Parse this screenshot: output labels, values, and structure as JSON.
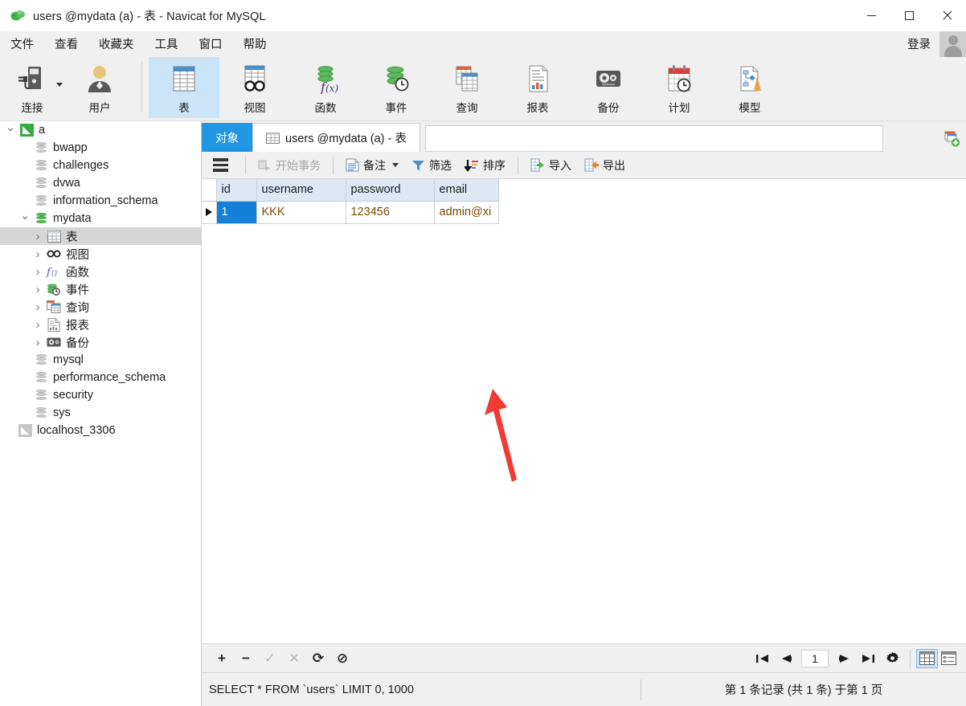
{
  "window": {
    "title": "users @mydata (a) - 表 - Navicat for MySQL",
    "app_icon": "navicat-logo-icon",
    "minimize": "─",
    "maximize": "□",
    "close": "✕"
  },
  "menubar": {
    "items": [
      {
        "label": "文件",
        "name": "menu-file"
      },
      {
        "label": "查看",
        "name": "menu-view"
      },
      {
        "label": "收藏夹",
        "name": "menu-favorites"
      },
      {
        "label": "工具",
        "name": "menu-tools"
      },
      {
        "label": "窗口",
        "name": "menu-window"
      },
      {
        "label": "帮助",
        "name": "menu-help"
      }
    ],
    "login_label": "登录"
  },
  "toolbar": {
    "items": [
      {
        "label": "连接",
        "icon": "connection-icon",
        "active": false,
        "caret": true
      },
      {
        "label": "用户",
        "icon": "user-icon",
        "active": false,
        "caret": false
      },
      {
        "label": "表",
        "icon": "table-icon",
        "active": true,
        "caret": false
      },
      {
        "label": "视图",
        "icon": "view-icon",
        "active": false,
        "caret": false
      },
      {
        "label": "函数",
        "icon": "function-icon",
        "active": false,
        "caret": false
      },
      {
        "label": "事件",
        "icon": "event-icon",
        "active": false,
        "caret": false
      },
      {
        "label": "查询",
        "icon": "query-icon",
        "active": false,
        "caret": false
      },
      {
        "label": "报表",
        "icon": "report-icon",
        "active": false,
        "caret": false
      },
      {
        "label": "备份",
        "icon": "backup-icon",
        "active": false,
        "caret": false
      },
      {
        "label": "计划",
        "icon": "schedule-icon",
        "active": false,
        "caret": false
      },
      {
        "label": "模型",
        "icon": "model-icon",
        "active": false,
        "caret": false
      }
    ]
  },
  "sidebar": {
    "tree": [
      {
        "label": "a",
        "icon": "connection-green-icon",
        "depth": 0,
        "expander": "open",
        "selected": false
      },
      {
        "label": "bwapp",
        "icon": "database-gray-icon",
        "depth": 1,
        "expander": "none",
        "selected": false
      },
      {
        "label": "challenges",
        "icon": "database-gray-icon",
        "depth": 1,
        "expander": "none",
        "selected": false
      },
      {
        "label": "dvwa",
        "icon": "database-gray-icon",
        "depth": 1,
        "expander": "none",
        "selected": false
      },
      {
        "label": "information_schema",
        "icon": "database-gray-icon",
        "depth": 1,
        "expander": "none",
        "selected": false
      },
      {
        "label": "mydata",
        "icon": "database-green-icon",
        "depth": 1,
        "expander": "open",
        "selected": false
      },
      {
        "label": "表",
        "icon": "table-icon",
        "depth": 2,
        "expander": "closed",
        "selected": true
      },
      {
        "label": "视图",
        "icon": "view-icon",
        "depth": 2,
        "expander": "closed",
        "selected": false
      },
      {
        "label": "函数",
        "icon": "function-icon",
        "depth": 2,
        "expander": "closed",
        "selected": false
      },
      {
        "label": "事件",
        "icon": "event-icon",
        "depth": 2,
        "expander": "closed",
        "selected": false
      },
      {
        "label": "查询",
        "icon": "query-icon",
        "depth": 2,
        "expander": "closed",
        "selected": false
      },
      {
        "label": "报表",
        "icon": "report-icon",
        "depth": 2,
        "expander": "closed",
        "selected": false
      },
      {
        "label": "备份",
        "icon": "backup-icon",
        "depth": 2,
        "expander": "closed",
        "selected": false
      },
      {
        "label": "mysql",
        "icon": "database-gray-icon",
        "depth": 1,
        "expander": "none",
        "selected": false
      },
      {
        "label": "performance_schema",
        "icon": "database-gray-icon",
        "depth": 1,
        "expander": "none",
        "selected": false
      },
      {
        "label": "security",
        "icon": "database-gray-icon",
        "depth": 1,
        "expander": "none",
        "selected": false
      },
      {
        "label": "sys",
        "icon": "database-gray-icon",
        "depth": 1,
        "expander": "none",
        "selected": false
      },
      {
        "label": "localhost_3306",
        "icon": "connection-gray-icon",
        "depth": 0,
        "expander": "none",
        "selected": false
      }
    ]
  },
  "tabs": {
    "objects_tab": "对象",
    "doc_tab": "users @mydata (a) - 表",
    "search_value": "",
    "add_tab_icon": "new-tab-icon"
  },
  "objbar": {
    "menu_icon": "hamburger-menu-icon",
    "begin_transaction": "开始事务",
    "note": "备注",
    "filter": "筛选",
    "sort": "排序",
    "import": "导入",
    "export": "导出"
  },
  "grid": {
    "columns": [
      "id",
      "username",
      "password",
      "email"
    ],
    "rows": [
      {
        "id": "1",
        "username": "KKK",
        "password": "123456",
        "email": "admin@xi"
      }
    ],
    "selected_row": 0,
    "selected_column": "id"
  },
  "annotation": {
    "type": "red-arrow",
    "color": "#ef3b34",
    "points_to": "username-cell"
  },
  "bottombar": {
    "add": "+",
    "remove": "−",
    "apply": "✓",
    "cancel": "✕",
    "refresh": "⟳",
    "stop": "⊘",
    "first_page": "first-page-icon",
    "prev_page": "prev-page-icon",
    "page_value": "1",
    "next_page": "next-page-icon",
    "last_page": "last-page-icon",
    "settings": "gear-icon",
    "grid_view": "grid-view-icon",
    "form_view": "form-view-icon"
  },
  "statusbar": {
    "sql": "SELECT * FROM `users` LIMIT 0, 1000",
    "record_info": "第 1 条记录 (共 1 条) 于第 1 页"
  },
  "colors": {
    "accent_blue": "#2196e3",
    "selection_blue": "#1480d8",
    "toolbar_bg": "#f0f0f0",
    "header_blue": "#dce9f5",
    "annotation_red": "#ef3b34",
    "tree_selected": "#d6d6d6",
    "toolbar_active": "#cce4f7"
  }
}
